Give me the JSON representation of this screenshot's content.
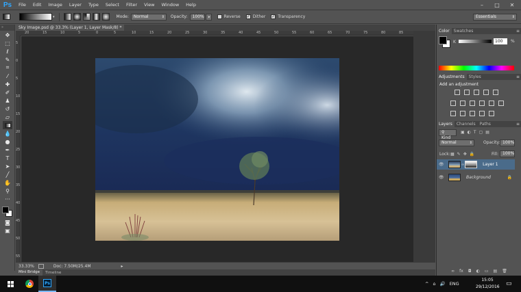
{
  "app": {
    "logo": "Ps"
  },
  "menu": [
    "File",
    "Edit",
    "Image",
    "Layer",
    "Type",
    "Select",
    "Filter",
    "View",
    "Window",
    "Help"
  ],
  "window_controls": {
    "minimize": "–",
    "maximize": "□",
    "close": "✕"
  },
  "options_bar": {
    "mode_label": "Mode:",
    "mode_value": "Normal",
    "opacity_label": "Opacity:",
    "opacity_value": "100%",
    "reverse_label": "Reverse",
    "dither_label": "Dither",
    "transparency_label": "Transparency",
    "reverse_checked": false,
    "dither_checked": true,
    "transparency_checked": true,
    "workspace": "Essentials"
  },
  "document": {
    "tab_title": "Sky Image.psd @ 33.3% (Layer 1, Layer Mask/8) *",
    "tab_close": "×",
    "ruler_top": [
      "20",
      "15",
      "10",
      "5",
      "0",
      "5",
      "10",
      "15",
      "20",
      "25",
      "30",
      "35",
      "40",
      "45",
      "50",
      "55",
      "60",
      "65",
      "70",
      "75",
      "80",
      "85"
    ],
    "ruler_left": [
      "5",
      "0",
      "5",
      "10",
      "15",
      "20",
      "25",
      "30",
      "35",
      "40",
      "45",
      "50",
      "55"
    ]
  },
  "status_bar": {
    "zoom": "33.33%",
    "doc_info": "Doc: 7.50M/25.4M"
  },
  "bottom_tabs": [
    "Mini Bridge",
    "Timeline"
  ],
  "color_panel": {
    "tabs": [
      "Color",
      "Swatches"
    ],
    "channel_label": "K",
    "value": "100",
    "unit": "%",
    "foreground": "#000000",
    "background": "#ffffff"
  },
  "adjustments_panel": {
    "tabs": [
      "Adjustments",
      "Styles"
    ],
    "heading": "Add an adjustment"
  },
  "layers_panel": {
    "tabs": [
      "Layers",
      "Channels",
      "Paths"
    ],
    "filter_label": "Kind",
    "blend_mode": "Normal",
    "opacity_label": "Opacity:",
    "opacity_value": "100%",
    "lock_label": "Lock:",
    "fill_label": "Fill:",
    "fill_value": "100%",
    "layers": [
      {
        "name": "Layer 1",
        "selected": true
      },
      {
        "name": "Background",
        "selected": false,
        "locked": true
      }
    ]
  },
  "taskbar": {
    "time": "15:05",
    "date": "29/12/2016",
    "language": "ENG"
  },
  "colors": {
    "ui_bg": "#535353",
    "canvas_bg": "#282828",
    "accent": "#31a8ff",
    "selected_layer": "#4a6b8a"
  }
}
